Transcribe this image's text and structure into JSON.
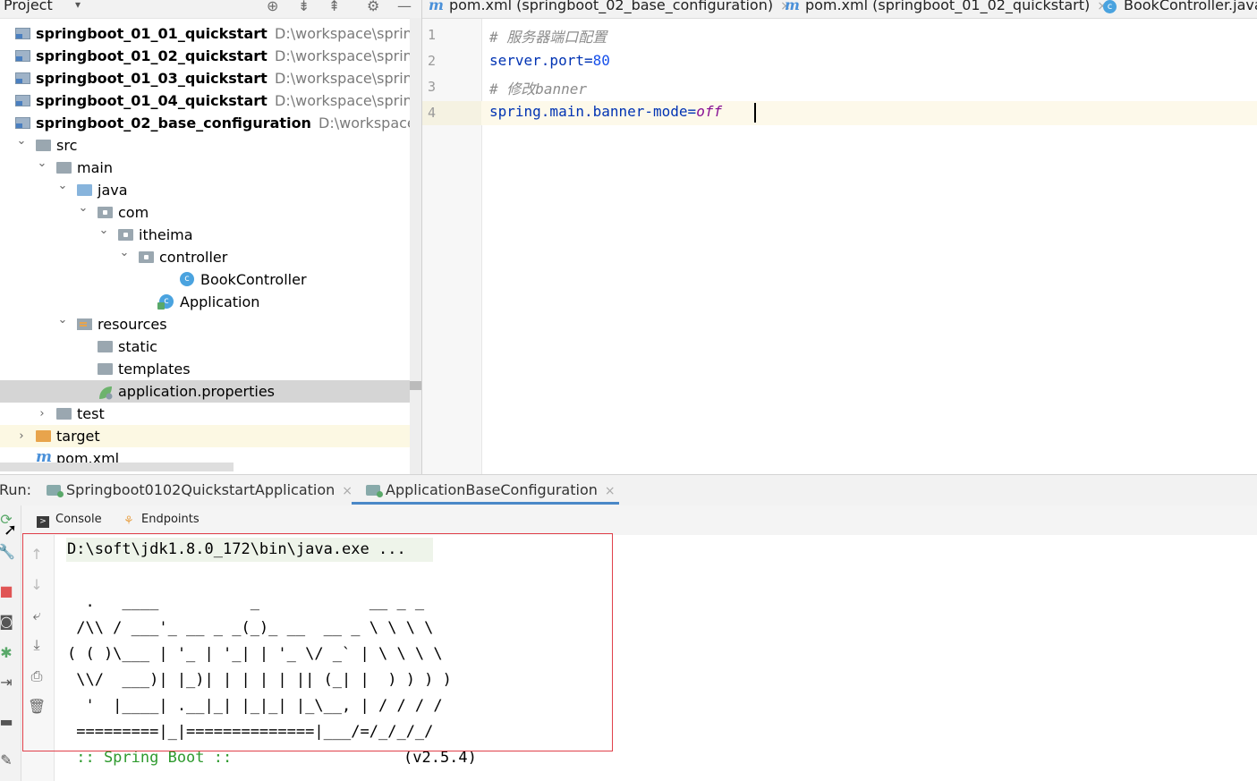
{
  "project_panel": {
    "title": "Project",
    "tree": [
      {
        "label": "springboot_01_01_quickstart",
        "path": "D:\\workspace\\springboo",
        "icon": "module-icon",
        "depth": 0,
        "bold": true
      },
      {
        "label": "springboot_01_02_quickstart",
        "path": "D:\\workspace\\springboo",
        "icon": "module-icon",
        "depth": 0,
        "bold": true
      },
      {
        "label": "springboot_01_03_quickstart",
        "path": "D:\\workspace\\springboo",
        "icon": "module-icon",
        "depth": 0,
        "bold": true
      },
      {
        "label": "springboot_01_04_quickstart",
        "path": "D:\\workspace\\springboo",
        "icon": "module-icon",
        "depth": 0,
        "bold": true
      },
      {
        "label": "springboot_02_base_configuration",
        "path": "D:\\workspace\\sprir",
        "icon": "module-icon",
        "depth": 0,
        "bold": true
      },
      {
        "label": "src",
        "icon": "folder-icon",
        "depth": 1,
        "expanded": true
      },
      {
        "label": "main",
        "icon": "folder-icon",
        "depth": 2,
        "expanded": true
      },
      {
        "label": "java",
        "icon": "source-folder-icon",
        "depth": 3,
        "expanded": true
      },
      {
        "label": "com",
        "icon": "package-icon",
        "depth": 4,
        "expanded": true
      },
      {
        "label": "itheima",
        "icon": "package-icon",
        "depth": 5,
        "expanded": true
      },
      {
        "label": "controller",
        "icon": "package-icon",
        "depth": 6,
        "expanded": true
      },
      {
        "label": "BookController",
        "icon": "class-icon",
        "depth": 8
      },
      {
        "label": "Application",
        "icon": "spring-app-icon",
        "depth": 7
      },
      {
        "label": "resources",
        "icon": "resources-folder-icon",
        "depth": 3,
        "expanded": true
      },
      {
        "label": "static",
        "icon": "folder-icon",
        "depth": 4
      },
      {
        "label": "templates",
        "icon": "folder-icon",
        "depth": 4
      },
      {
        "label": "application.properties",
        "icon": "properties-icon",
        "depth": 4,
        "selected": true
      },
      {
        "label": "test",
        "icon": "folder-icon",
        "depth": 2,
        "expanded": false
      },
      {
        "label": "target",
        "icon": "target-folder-icon",
        "depth": 1,
        "expanded": false
      },
      {
        "label": "pom.xml",
        "icon": "maven-icon",
        "depth": 1
      }
    ]
  },
  "editor": {
    "tabs": [
      {
        "label": "pom.xml (springboot_02_base_configuration)",
        "icon": "maven-icon"
      },
      {
        "label": "pom.xml (springboot_01_02_quickstart)",
        "icon": "maven-icon"
      },
      {
        "label": "BookController.java",
        "icon": "class-icon"
      }
    ],
    "lines": [
      "1",
      "2",
      "3",
      "4"
    ],
    "code": {
      "l1": "# 服务器端口配置",
      "l2_key": "server.port=",
      "l2_val": "80",
      "l3": "# 修改banner",
      "l4_key": "spring.main.banner-mode=",
      "l4_val": "off"
    }
  },
  "run_panel": {
    "label": "Run:",
    "tabs": [
      "Springboot0102QuickstartApplication",
      "ApplicationBaseConfiguration"
    ],
    "subtabs": {
      "console": "Console",
      "endpoints": "Endpoints"
    },
    "console": {
      "cmd": "D:\\soft\\jdk1.8.0_172\\bin\\java.exe ...",
      "banner": [
        "  .   ____          _            __ _ _",
        " /\\\\ / ___'_ __ _ _(_)_ __  __ _ \\ \\ \\ \\",
        "( ( )\\___ | '_ | '_| | '_ \\/ _` | \\ \\ \\ \\",
        " \\\\/  ___)| |_)| | | | | || (_| |  ) ) ) )",
        "  '  |____| .__|_| |_|_| |_\\__, | / / / /",
        " =========|_|==============|___/=/_/_/_/"
      ],
      "spring_label": " :: Spring Boot ::",
      "version": "(v2.5.4)"
    }
  },
  "colors": {
    "accent": "#4a88c7",
    "highlight_box": "#e0404a",
    "selection": "#d5d5d5"
  }
}
